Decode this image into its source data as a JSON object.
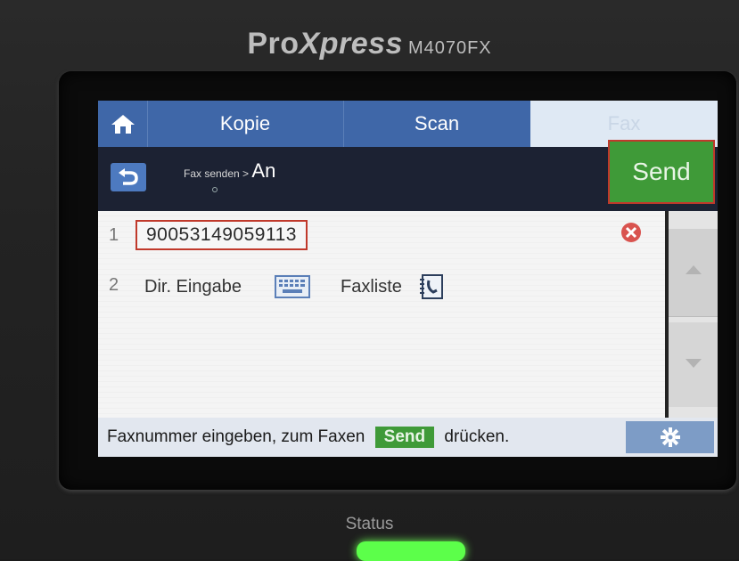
{
  "device": {
    "brand_part1": "Pro",
    "brand_part2": "Xpress",
    "model": "M4070FX",
    "status_label": "Status"
  },
  "tabs": [
    {
      "label": "Kopie",
      "active": false
    },
    {
      "label": "Scan",
      "active": false
    },
    {
      "label": "Fax",
      "active": true
    }
  ],
  "header": {
    "breadcrumb_parent": "Fax senden",
    "separator": " > ",
    "breadcrumb_current": "An",
    "send_label": "Send"
  },
  "recipients": {
    "row1_index": "1",
    "row1_number": "90053149059113",
    "row2_index": "2",
    "direct_entry_label": "Dir. Eingabe",
    "fax_list_label": "Faxliste"
  },
  "status_bar": {
    "text_before": "Faxnummer eingeben, zum Faxen",
    "send_word": "Send",
    "text_after": "drücken."
  },
  "icons": {
    "home": "home-icon",
    "back": "back-arrow-icon",
    "delete": "delete-icon",
    "keyboard": "keyboard-icon",
    "phonebook": "phonebook-icon",
    "scroll_up": "chevron-up-icon",
    "scroll_down": "chevron-down-icon",
    "settings": "gear-icon"
  },
  "colors": {
    "tab_bar": "#3f67a8",
    "send_green": "#3f9a38",
    "highlight_red": "#c0392b",
    "status_led": "#5cff4a"
  }
}
